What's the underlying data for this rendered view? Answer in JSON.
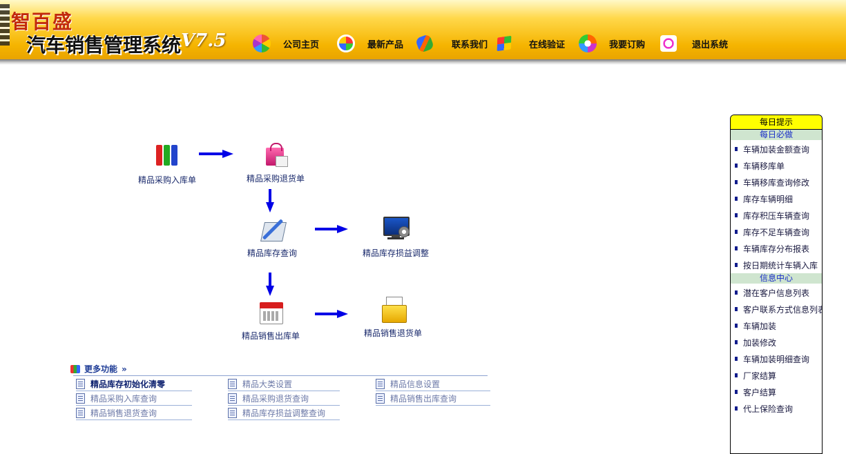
{
  "header": {
    "brand_cn": "智百盛",
    "title": "汽车销售管理系统",
    "version": "V7.5",
    "nav": [
      {
        "label": "公司主页",
        "icon": "color-ball-icon"
      },
      {
        "label": "最新产品",
        "icon": "color-flower-icon"
      },
      {
        "label": "联系我们",
        "icon": "chain-link-icon"
      },
      {
        "label": "在线验证",
        "icon": "windows-flag-icon"
      },
      {
        "label": "我要订购",
        "icon": "color-disc-icon"
      },
      {
        "label": "退出系统",
        "icon": "magnifier-icon"
      }
    ]
  },
  "flow": {
    "purchase_in": "精品采购入库单",
    "purchase_return": "精品采购退货单",
    "stock_query": "精品库存查询",
    "stock_adjust": "精品库存损益调整",
    "sale_out": "精品销售出库单",
    "sale_return": "精品销售退货单"
  },
  "more": {
    "title": "更多功能",
    "links": [
      "精品库存初始化清零",
      "精品大类设置",
      "精品信息设置",
      "精品采购入库查询",
      "精品采购退货查询",
      "精品销售出库查询",
      "精品销售退货查询",
      "精品库存损益调整查询"
    ]
  },
  "panel": {
    "title": "每日提示",
    "section1": "每日必做",
    "daily": [
      "车辆加装金额查询",
      "车辆移库单",
      "车辆移库查询修改",
      "库存车辆明细",
      "库存积压车辆查询",
      "库存不足车辆查询",
      "车辆库存分布报表",
      "按日期统计车辆入库"
    ],
    "section2": "信息中心",
    "info": [
      "潜在客户信息列表",
      "客户联系方式信息列表",
      "车辆加装",
      "加装修改",
      "车辆加装明细查询",
      "厂家结算",
      "客户结算",
      "代上保险查询"
    ]
  }
}
